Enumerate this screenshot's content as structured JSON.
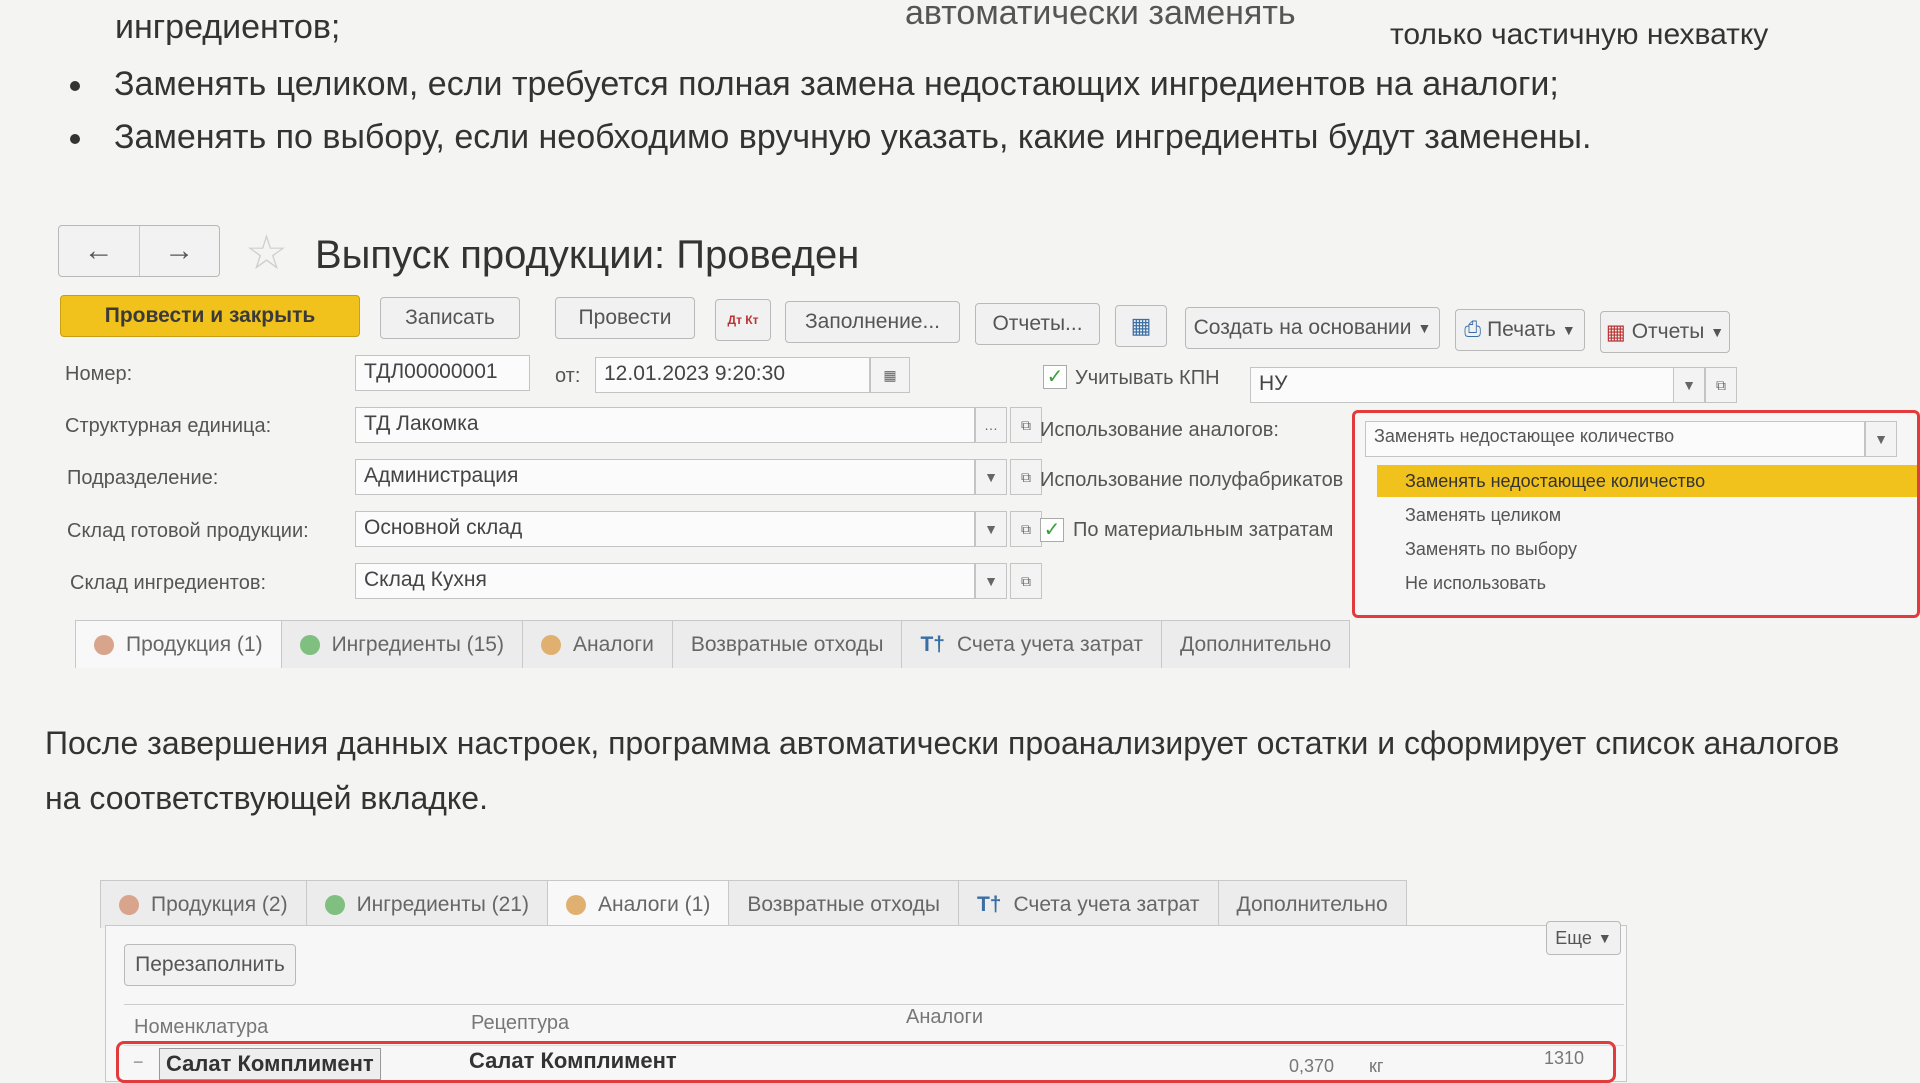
{
  "article": {
    "line_top": "ингредиентов;",
    "line_top_right": "только частичную нехватку",
    "line_top_mid": "автоматически заменять",
    "bullet1": "Заменять целиком, если требуется полная замена недостающих ингредиентов на аналоги;",
    "bullet2": "Заменять по выбору, если необходимо вручную указать, какие ингредиенты будут заменены.",
    "after_para1": "После завершения данных настроек, программа автоматически проанализирует остатки и сформирует список аналогов",
    "after_para2": "на соответствующей вкладке."
  },
  "form": {
    "title": "Выпуск продукции: Проведен",
    "toolbar": {
      "post_close": "Провести и закрыть",
      "save": "Записать",
      "post": "Провести",
      "dt_kt": "Дт Кт",
      "fill": "Заполнение...",
      "reports": "Отчеты...",
      "create_based": "Создать на основании",
      "print": "Печать",
      "reports2": "Отчеты"
    },
    "fields": {
      "number_label": "Номер:",
      "number_value": "ТДЛ00000001",
      "from_label": "от:",
      "date_value": "12.01.2023  9:20:30",
      "kpn_label": "Учитывать КПН",
      "kpn_value": "НУ",
      "unit_label": "Структурная единица:",
      "unit_value": "ТД Лакомка",
      "dept_label": "Подразделение:",
      "dept_value": "Администрация",
      "finished_wh_label": "Склад готовой продукции:",
      "finished_wh_value": "Основной склад",
      "ingr_wh_label": "Склад ингредиентов:",
      "ingr_wh_value": "Склад Кухня",
      "analogs_label": "Использование аналогов:",
      "analogs_value": "Заменять недостающее количество",
      "semi_label": "Использование полуфабрикатов",
      "material_label": "По материальным затратам"
    },
    "dropdown_options": [
      "Заменять недостающее количество",
      "Заменять целиком",
      "Заменять по выбору",
      "Не использовать"
    ],
    "tabs": [
      "Продукция (1)",
      "Ингредиенты (15)",
      "Аналоги",
      "Возвратные отходы",
      "Счета учета затрат",
      "Дополнительно"
    ]
  },
  "second": {
    "tabs": [
      "Продукция (2)",
      "Ингредиенты (21)",
      "Аналоги (1)",
      "Возвратные отходы",
      "Счета учета затрат",
      "Дополнительно"
    ],
    "refill": "Перезаполнить",
    "more": "Еще",
    "col_nomen": "Номенклатура",
    "col_recipe": "Рецептура",
    "col_analogs": "Аналоги",
    "row_nomen": "Салат Комплимент",
    "row_recipe": "Салат Комплимент",
    "row_qty": "0,370",
    "row_unit": "кг",
    "row_num": "1310"
  },
  "colors": {
    "accent": "#f1c21c",
    "highlight_border": "#e23b3b"
  }
}
